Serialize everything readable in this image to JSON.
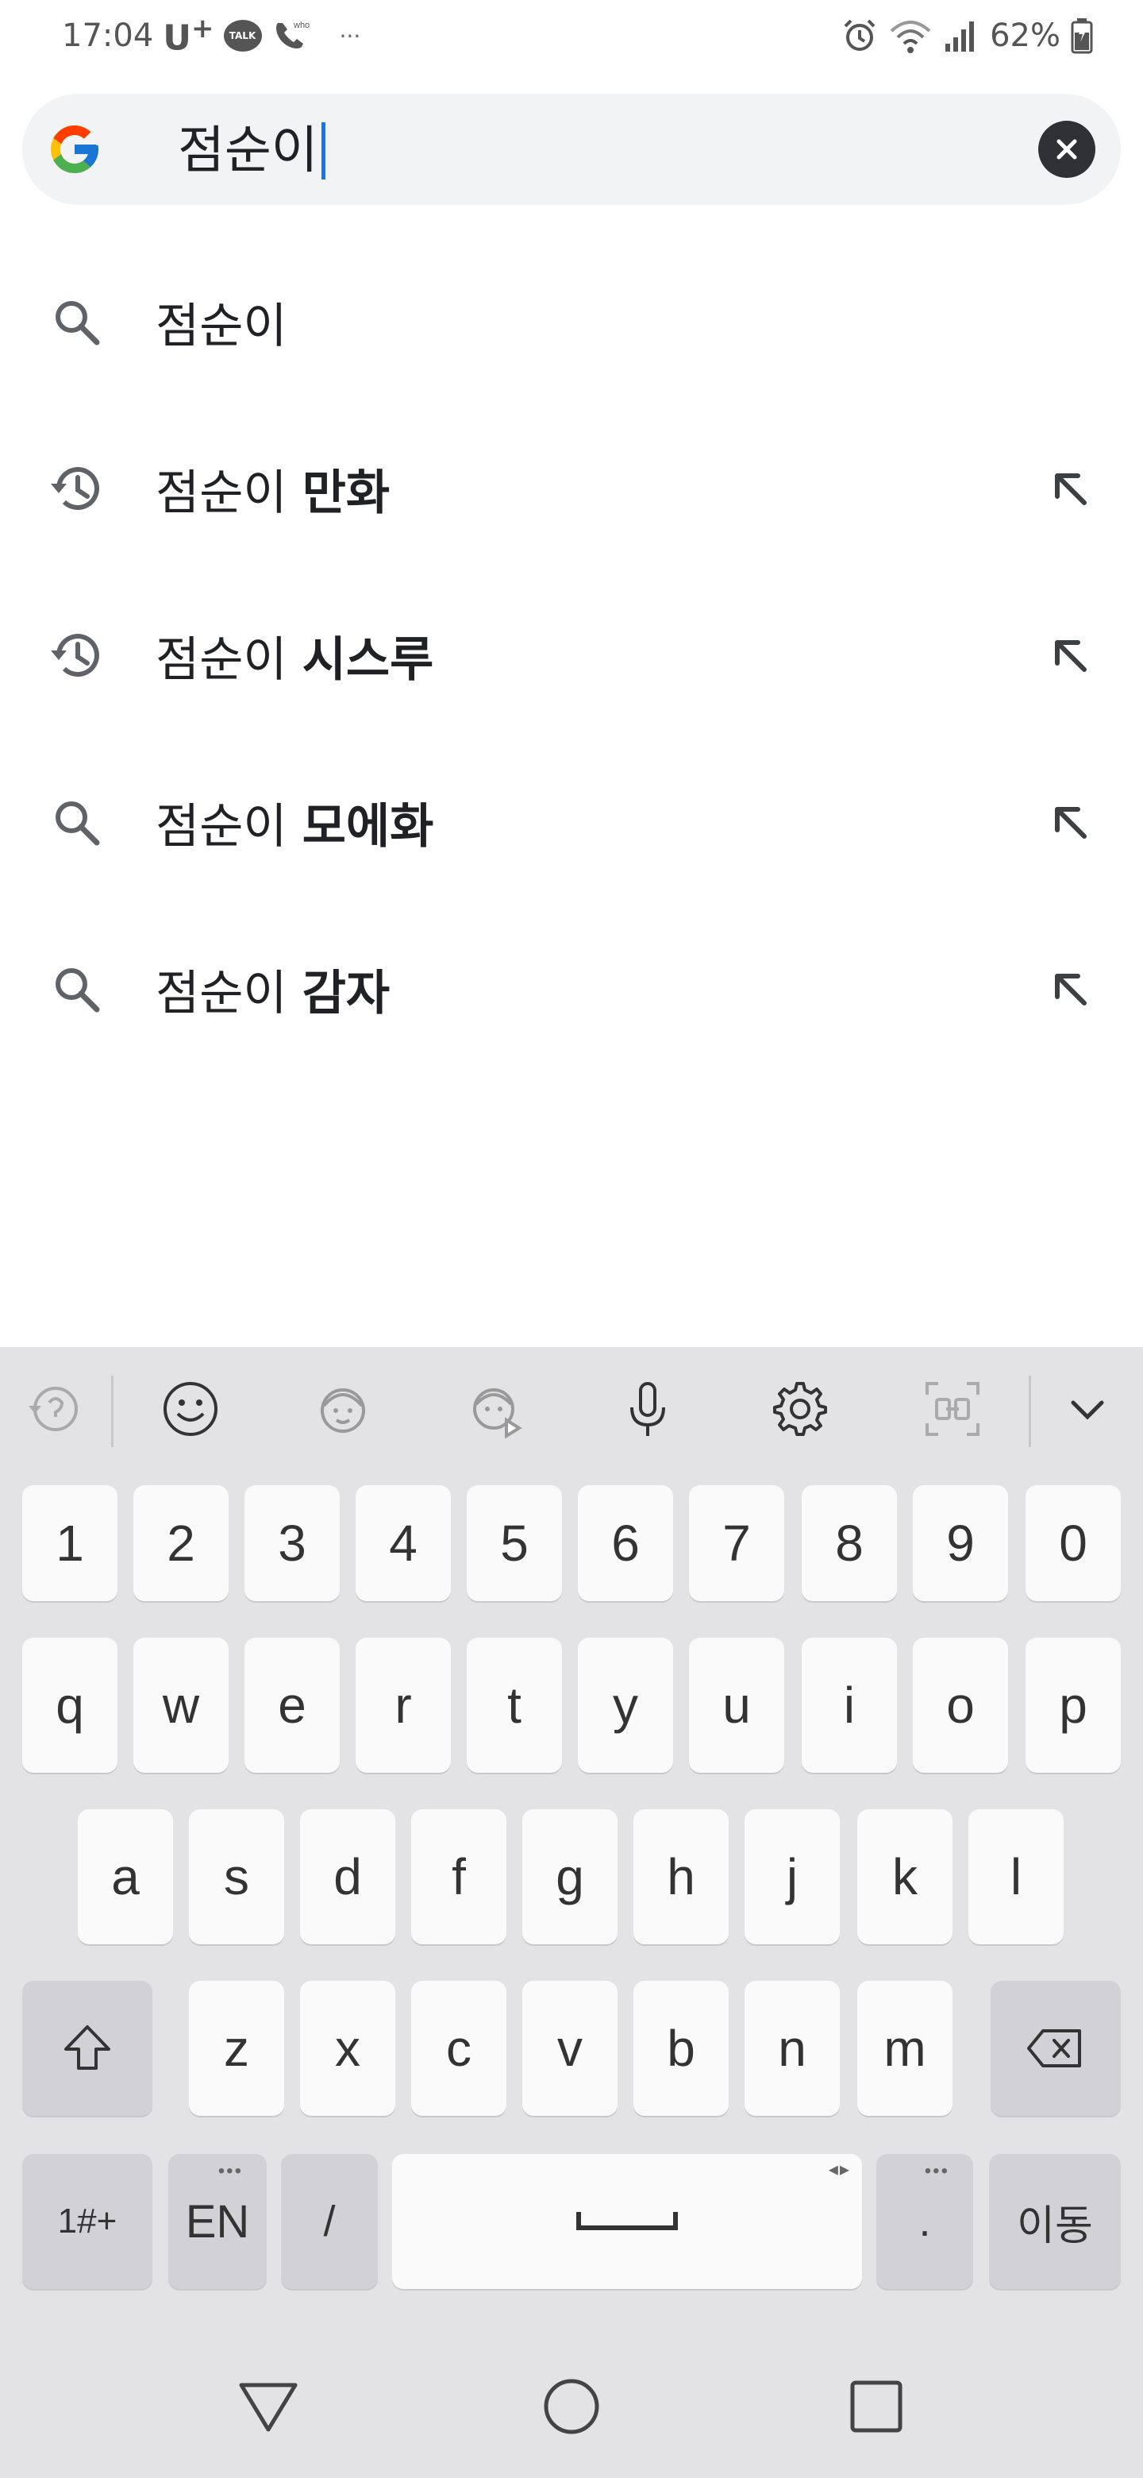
{
  "status_bar": {
    "time": "17:04",
    "carrier": "U",
    "carrier_sup": "+",
    "talk_badge": "TALK",
    "who_badge": "who",
    "more": "···",
    "battery_percent": "62%",
    "icons": [
      "alarm-icon",
      "wifi-icon",
      "signal-icon",
      "battery-icon"
    ]
  },
  "search": {
    "query": "점순이",
    "icon": "google-logo",
    "clear_icon": "close-icon"
  },
  "suggestions": [
    {
      "type": "search",
      "prefix": "점순이",
      "completion": "",
      "fill_arrow": false
    },
    {
      "type": "history",
      "prefix": "점순이 ",
      "completion": "만화",
      "fill_arrow": true
    },
    {
      "type": "history",
      "prefix": "점순이 ",
      "completion": "시스루",
      "fill_arrow": true
    },
    {
      "type": "search",
      "prefix": "점순이 ",
      "completion": "모에화",
      "fill_arrow": true
    },
    {
      "type": "search",
      "prefix": "점순이 ",
      "completion": "감자",
      "fill_arrow": true
    }
  ],
  "keyboard": {
    "toolbar": [
      "recent-icon",
      "emoji-icon",
      "bitmoji-icon",
      "animated-sticker-icon",
      "microphone-icon",
      "settings-icon",
      "translate-icon",
      "chevron-down-icon"
    ],
    "row_numbers": [
      "1",
      "2",
      "3",
      "4",
      "5",
      "6",
      "7",
      "8",
      "9",
      "0"
    ],
    "row1": [
      "q",
      "w",
      "e",
      "r",
      "t",
      "y",
      "u",
      "i",
      "o",
      "p"
    ],
    "row2": [
      "a",
      "s",
      "d",
      "f",
      "g",
      "h",
      "j",
      "k",
      "l"
    ],
    "row3": [
      "z",
      "x",
      "c",
      "v",
      "b",
      "n",
      "m"
    ],
    "symbols_label": "1#+",
    "lang_label": "EN",
    "slash_label": "/",
    "period_label": ".",
    "enter_label": "이동"
  },
  "nav": [
    "back-icon",
    "home-icon",
    "recents-icon"
  ],
  "colors": {
    "caret": "#1a73e8",
    "keyboard_bg": "#e3e3e5",
    "key_bg": "#fafafa",
    "search_bg": "#f1f3f4"
  }
}
